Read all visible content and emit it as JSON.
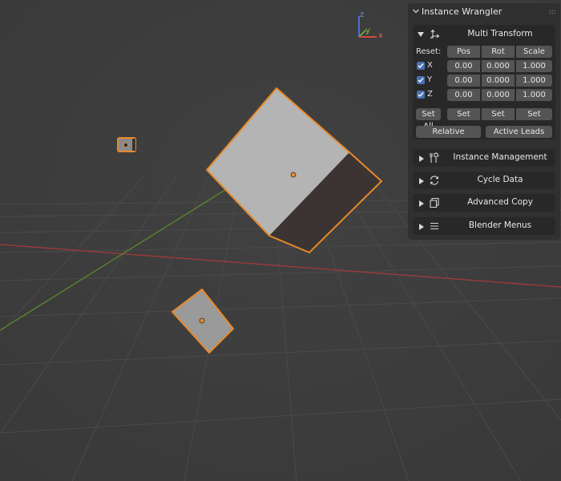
{
  "gizmo": {
    "z": "z",
    "y": "y",
    "x": "x"
  },
  "panel": {
    "title": "Instance Wrangler",
    "multi_transform": {
      "title": "Multi Transform",
      "reset_label": "Reset:",
      "columns": [
        "Pos",
        "Rot",
        "Scale"
      ],
      "rows": [
        {
          "axis": "X",
          "checked": true,
          "pos": "0.00",
          "rot": "0.000",
          "scale": "1.000"
        },
        {
          "axis": "Y",
          "checked": true,
          "pos": "0.00",
          "rot": "0.000",
          "scale": "1.000"
        },
        {
          "axis": "Z",
          "checked": true,
          "pos": "0.00",
          "rot": "0.000",
          "scale": "1.000"
        }
      ],
      "set_all_label": "Set All",
      "set_label": "Set",
      "relative_label": "Relative",
      "active_leads_label": "Active Leads"
    },
    "sections": [
      {
        "title": "Instance Management",
        "icon": "tools-icon"
      },
      {
        "title": "Cycle Data",
        "icon": "cycle-icon"
      },
      {
        "title": "Advanced Copy",
        "icon": "copy-icon"
      },
      {
        "title": "Blender Menus",
        "icon": "menu-icon"
      }
    ]
  },
  "colors": {
    "viewport_bg": "#3d3d3d",
    "selection_outline": "#e8892a",
    "x_axis": "#a33a3a",
    "y_axis": "#5a8a2a",
    "checkbox": "#4772b3"
  }
}
